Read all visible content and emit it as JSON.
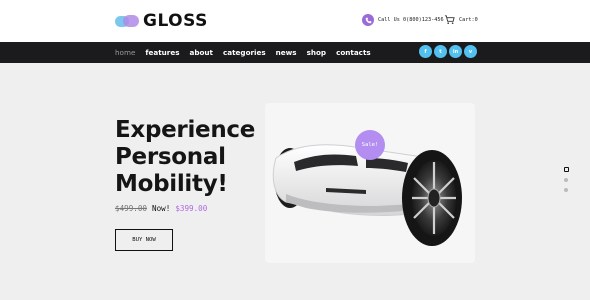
{
  "brand": {
    "name": "GLOSS",
    "logo_icon": "cloud-logo-icon"
  },
  "header": {
    "call_label": "Call Us 0(800)123-456",
    "call_icon": "phone-icon",
    "cart_label": "Cart:0",
    "cart_icon": "cart-icon"
  },
  "nav": {
    "items": [
      {
        "label": "home",
        "active": true
      },
      {
        "label": "features"
      },
      {
        "label": "about"
      },
      {
        "label": "categories"
      },
      {
        "label": "news"
      },
      {
        "label": "shop"
      },
      {
        "label": "contacts"
      }
    ],
    "socials": [
      {
        "name": "facebook-icon",
        "glyph": "f"
      },
      {
        "name": "twitter-icon",
        "glyph": "t"
      },
      {
        "name": "linkedin-icon",
        "glyph": "in"
      },
      {
        "name": "vimeo-icon",
        "glyph": "v"
      }
    ]
  },
  "hero": {
    "headline": [
      "Experience",
      "Personal",
      "Mobility!"
    ],
    "old_price": "$499.00",
    "now_label": "Now!",
    "new_price": "$399.00",
    "buy_label": "BUY NOW",
    "sale_badge": "Sale!",
    "slides_count": 3,
    "active_slide": 1
  },
  "colors": {
    "accent": "#b38ef0",
    "price": "#b06ae0",
    "nav_bg": "#1b1b1d",
    "social": "#53c1ef",
    "hero_bg": "#efefef"
  }
}
